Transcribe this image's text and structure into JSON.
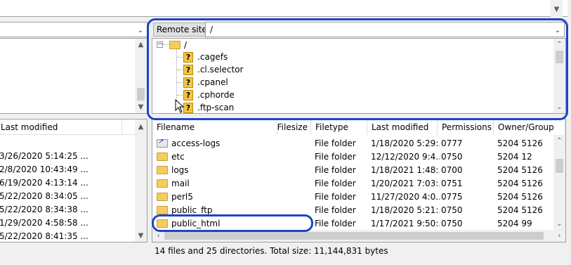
{
  "remote_site": {
    "label": "Remote site:",
    "path": "/",
    "tree": [
      {
        "name": "/",
        "icon": "folder-icon"
      },
      {
        "name": ".cagefs",
        "icon": "question-folder-icon"
      },
      {
        "name": ".cl.selector",
        "icon": "question-folder-icon"
      },
      {
        "name": ".cpanel",
        "icon": "question-folder-icon"
      },
      {
        "name": ".cphorde",
        "icon": "question-folder-icon"
      },
      {
        "name": ".ftp-scan",
        "icon": "question-folder-icon"
      }
    ]
  },
  "local_list": {
    "header_last_modified": "Last modified",
    "dates": [
      "3/26/2020 5:14:25 ...",
      "2/8/2020 10:43:49 ...",
      "6/19/2020 4:13:14 ...",
      "5/22/2020 8:34:05 ...",
      "5/22/2020 8:34:38 ...",
      "1/29/2020 4:58:58 ...",
      "5/22/2020 8:41:35 ..."
    ]
  },
  "remote_list": {
    "headers": {
      "filename": "Filename",
      "filesize": "Filesize",
      "filetype": "Filetype",
      "last_modified": "Last modified",
      "permissions": "Permissions",
      "owner_group": "Owner/Group"
    },
    "rows": [
      {
        "name": "access-logs",
        "size": "",
        "type": "File folder",
        "modified": "1/18/2020 5:29:...",
        "perms": "0777",
        "owner": "5204 5126",
        "icon": "shortcut-folder-icon"
      },
      {
        "name": "etc",
        "size": "",
        "type": "File folder",
        "modified": "12/12/2020 9:4...",
        "perms": "0750",
        "owner": "5204 12",
        "icon": "folder-icon"
      },
      {
        "name": "logs",
        "size": "",
        "type": "File folder",
        "modified": "1/18/2021 1:48:...",
        "perms": "0700",
        "owner": "5204 5126",
        "icon": "folder-icon"
      },
      {
        "name": "mail",
        "size": "",
        "type": "File folder",
        "modified": "1/20/2021 7:03:...",
        "perms": "0751",
        "owner": "5204 5126",
        "icon": "folder-icon"
      },
      {
        "name": "perl5",
        "size": "",
        "type": "File folder",
        "modified": "11/27/2020 4:0...",
        "perms": "0775",
        "owner": "5204 5126",
        "icon": "folder-icon"
      },
      {
        "name": "public_ftp",
        "size": "",
        "type": "File folder",
        "modified": "1/18/2020 5:21:...",
        "perms": "0750",
        "owner": "5204 5126",
        "icon": "folder-icon"
      },
      {
        "name": "public_html",
        "size": "",
        "type": "File folder",
        "modified": "1/17/2021 9:50:...",
        "perms": "0750",
        "owner": "5204 99",
        "icon": "folder-icon"
      }
    ],
    "status": "14 files and 25 directories. Total size: 11,144,831 bytes"
  },
  "colors": {
    "highlight": "#1f44c9",
    "folder": "#f4cd5b"
  }
}
